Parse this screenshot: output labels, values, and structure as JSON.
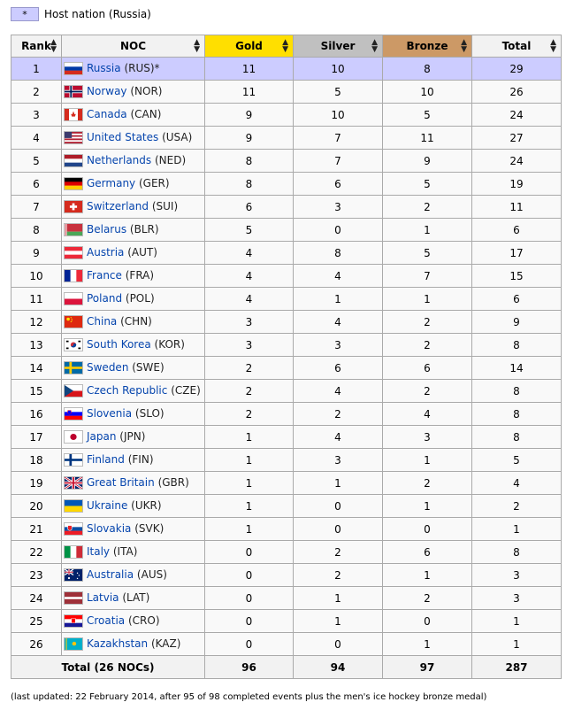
{
  "legend": {
    "symbol": "*",
    "text": "Host nation (Russia)"
  },
  "headers": {
    "rank": "Rank",
    "noc": "NOC",
    "gold": "Gold",
    "silver": "Silver",
    "bronze": "Bronze",
    "total": "Total"
  },
  "header_colors": {
    "gold": "#ffdf00",
    "silver": "#c0c0c0",
    "bronze": "#cc9966",
    "host": "#ccccff"
  },
  "rows": [
    {
      "rank": "1",
      "country": "Russia",
      "code": "(RUS)*",
      "gold": "11",
      "silver": "10",
      "bronze": "8",
      "total": "29",
      "flag": "rus"
    },
    {
      "rank": "2",
      "country": "Norway",
      "code": "(NOR)",
      "gold": "11",
      "silver": "5",
      "bronze": "10",
      "total": "26",
      "flag": "nor"
    },
    {
      "rank": "3",
      "country": "Canada",
      "code": "(CAN)",
      "gold": "9",
      "silver": "10",
      "bronze": "5",
      "total": "24",
      "flag": "can"
    },
    {
      "rank": "4",
      "country": "United States",
      "code": "(USA)",
      "gold": "9",
      "silver": "7",
      "bronze": "11",
      "total": "27",
      "flag": "usa"
    },
    {
      "rank": "5",
      "country": "Netherlands",
      "code": "(NED)",
      "gold": "8",
      "silver": "7",
      "bronze": "9",
      "total": "24",
      "flag": "ned"
    },
    {
      "rank": "6",
      "country": "Germany",
      "code": "(GER)",
      "gold": "8",
      "silver": "6",
      "bronze": "5",
      "total": "19",
      "flag": "ger"
    },
    {
      "rank": "7",
      "country": "Switzerland",
      "code": "(SUI)",
      "gold": "6",
      "silver": "3",
      "bronze": "2",
      "total": "11",
      "flag": "sui"
    },
    {
      "rank": "8",
      "country": "Belarus",
      "code": "(BLR)",
      "gold": "5",
      "silver": "0",
      "bronze": "1",
      "total": "6",
      "flag": "blr"
    },
    {
      "rank": "9",
      "country": "Austria",
      "code": "(AUT)",
      "gold": "4",
      "silver": "8",
      "bronze": "5",
      "total": "17",
      "flag": "aut"
    },
    {
      "rank": "10",
      "country": "France",
      "code": "(FRA)",
      "gold": "4",
      "silver": "4",
      "bronze": "7",
      "total": "15",
      "flag": "fra"
    },
    {
      "rank": "11",
      "country": "Poland",
      "code": "(POL)",
      "gold": "4",
      "silver": "1",
      "bronze": "1",
      "total": "6",
      "flag": "pol"
    },
    {
      "rank": "12",
      "country": "China",
      "code": "(CHN)",
      "gold": "3",
      "silver": "4",
      "bronze": "2",
      "total": "9",
      "flag": "chn"
    },
    {
      "rank": "13",
      "country": "South Korea",
      "code": "(KOR)",
      "gold": "3",
      "silver": "3",
      "bronze": "2",
      "total": "8",
      "flag": "kor"
    },
    {
      "rank": "14",
      "country": "Sweden",
      "code": "(SWE)",
      "gold": "2",
      "silver": "6",
      "bronze": "6",
      "total": "14",
      "flag": "swe"
    },
    {
      "rank": "15",
      "country": "Czech Republic",
      "code": "(CZE)",
      "gold": "2",
      "silver": "4",
      "bronze": "2",
      "total": "8",
      "flag": "cze"
    },
    {
      "rank": "16",
      "country": "Slovenia",
      "code": "(SLO)",
      "gold": "2",
      "silver": "2",
      "bronze": "4",
      "total": "8",
      "flag": "slo"
    },
    {
      "rank": "17",
      "country": "Japan",
      "code": "(JPN)",
      "gold": "1",
      "silver": "4",
      "bronze": "3",
      "total": "8",
      "flag": "jpn"
    },
    {
      "rank": "18",
      "country": "Finland",
      "code": "(FIN)",
      "gold": "1",
      "silver": "3",
      "bronze": "1",
      "total": "5",
      "flag": "fin"
    },
    {
      "rank": "19",
      "country": "Great Britain",
      "code": "(GBR)",
      "gold": "1",
      "silver": "1",
      "bronze": "2",
      "total": "4",
      "flag": "gbr"
    },
    {
      "rank": "20",
      "country": "Ukraine",
      "code": "(UKR)",
      "gold": "1",
      "silver": "0",
      "bronze": "1",
      "total": "2",
      "flag": "ukr"
    },
    {
      "rank": "21",
      "country": "Slovakia",
      "code": "(SVK)",
      "gold": "1",
      "silver": "0",
      "bronze": "0",
      "total": "1",
      "flag": "svk"
    },
    {
      "rank": "22",
      "country": "Italy",
      "code": "(ITA)",
      "gold": "0",
      "silver": "2",
      "bronze": "6",
      "total": "8",
      "flag": "ita"
    },
    {
      "rank": "23",
      "country": "Australia",
      "code": "(AUS)",
      "gold": "0",
      "silver": "2",
      "bronze": "1",
      "total": "3",
      "flag": "aus"
    },
    {
      "rank": "24",
      "country": "Latvia",
      "code": "(LAT)",
      "gold": "0",
      "silver": "1",
      "bronze": "2",
      "total": "3",
      "flag": "lat"
    },
    {
      "rank": "25",
      "country": "Croatia",
      "code": "(CRO)",
      "gold": "0",
      "silver": "1",
      "bronze": "0",
      "total": "1",
      "flag": "cro"
    },
    {
      "rank": "26",
      "country": "Kazakhstan",
      "code": "(KAZ)",
      "gold": "0",
      "silver": "0",
      "bronze": "1",
      "total": "1",
      "flag": "kaz"
    }
  ],
  "total_row": {
    "label": "Total (26 NOCs)",
    "gold": "96",
    "silver": "94",
    "bronze": "97",
    "total": "287"
  },
  "footnote": "(last updated: 22 February 2014, after 95 of 98 completed events plus the men's ice hockey bronze medal)",
  "sort_glyph": "▲▼"
}
